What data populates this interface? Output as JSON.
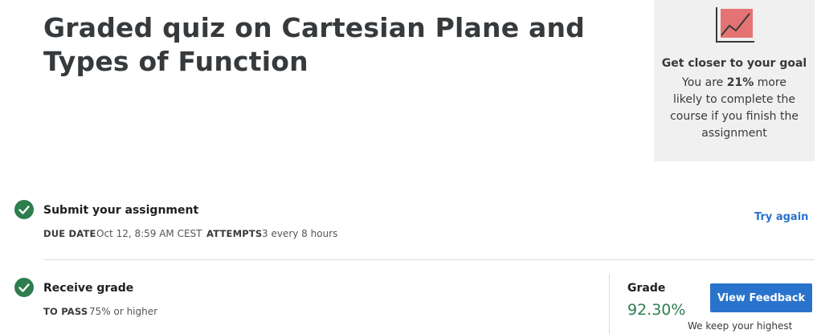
{
  "header": {
    "title": "Graded quiz on Cartesian Plane and Types of Function"
  },
  "goal_card": {
    "icon": "trend-chart-icon",
    "heading": "Get closer to your goal",
    "text_prefix": "You are",
    "percent": "21%",
    "text_suffix": "more likely to complete the course if you finish the assignment"
  },
  "submit_step": {
    "icon": "check-circle-icon",
    "title": "Submit your assignment",
    "due_date_label": "DUE DATE",
    "due_date_value": "Oct 12, 8:59 AM CEST",
    "attempts_label": "ATTEMPTS",
    "attempts_value": "3 every 8 hours",
    "try_again_label": "Try again"
  },
  "grade_step": {
    "icon": "check-circle-icon",
    "title": "Receive grade",
    "to_pass_label": "TO PASS",
    "to_pass_value": "75% or higher",
    "grade_label": "Grade",
    "grade_value": "92.30%",
    "view_feedback_label": "View Feedback",
    "keep_note": "We keep your highest score"
  },
  "colors": {
    "success": "#2e7d4f",
    "link": "#2a73cc",
    "card_bg": "#f0f0f0",
    "chart_fill": "#e57373"
  }
}
